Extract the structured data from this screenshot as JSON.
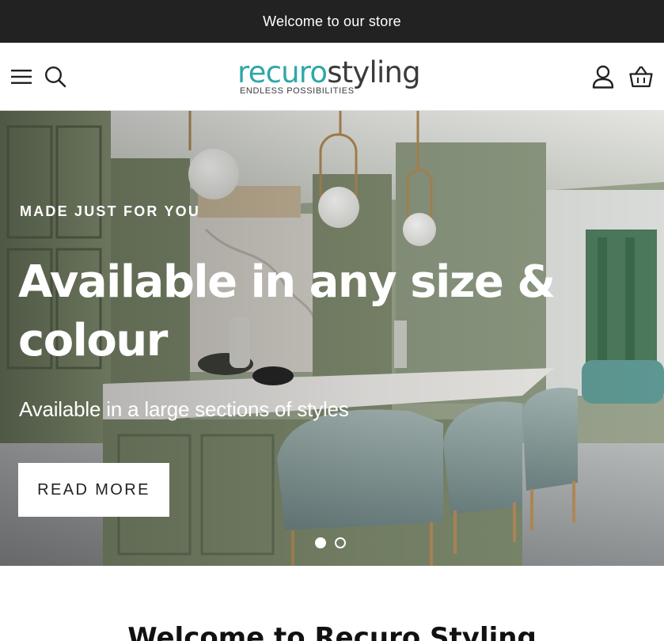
{
  "announcement": {
    "text": "Welcome to our store"
  },
  "header": {
    "logo": {
      "part1": "recuro",
      "part2": "styling",
      "tagline": "ENDLESS POSSIBILITIES"
    },
    "icons": {
      "menu": "menu-icon",
      "search": "search-icon",
      "account": "account-icon",
      "cart": "basket-icon"
    }
  },
  "hero": {
    "eyebrow": "MADE JUST FOR YOU",
    "title_line1": "Available in any size &",
    "title_line2": "colour",
    "subtitle": "Available in a large sections of styles",
    "cta_label": "READ MORE",
    "slides": {
      "total": 2,
      "active": 1
    }
  },
  "welcome": {
    "heading": "Welcome to Recuro Styling"
  },
  "colors": {
    "announcement_bg": "#222222",
    "brand_teal": "#2fa8a8",
    "brand_dark": "#3b3b3b"
  }
}
